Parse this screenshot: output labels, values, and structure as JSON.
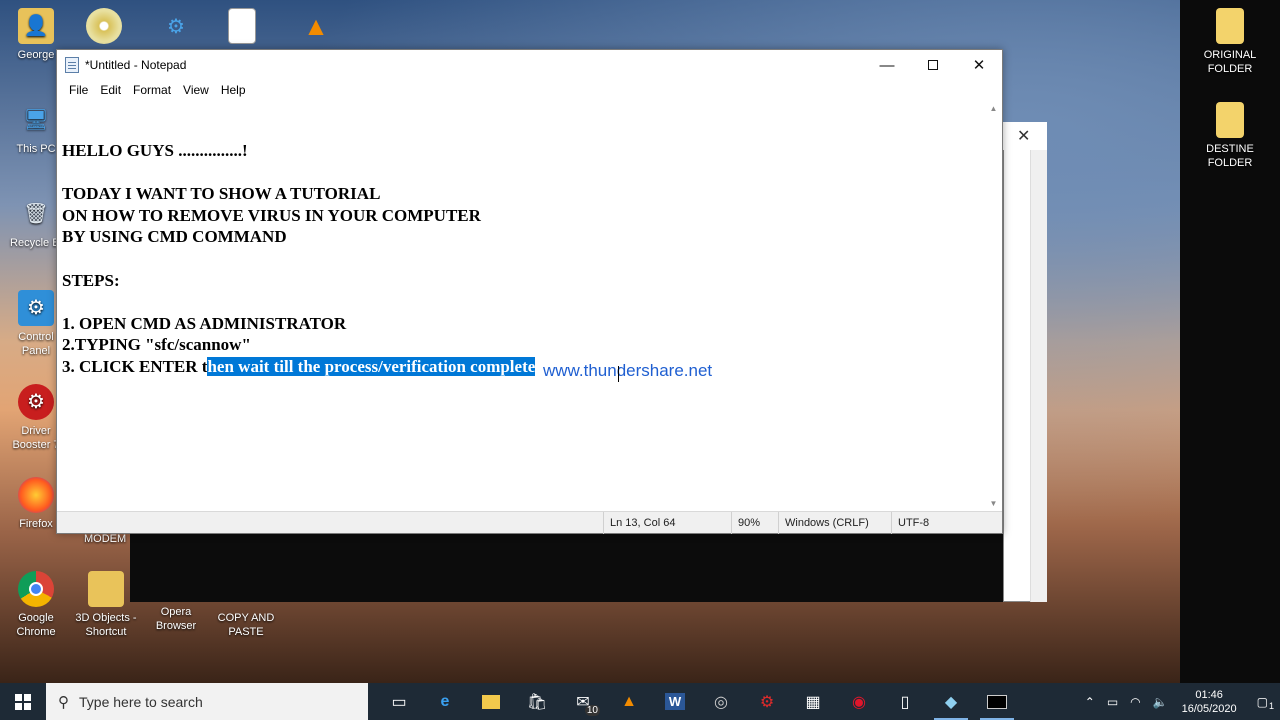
{
  "desktop": {
    "left_icons": [
      {
        "label": "George",
        "icon": "user-folder-icon"
      },
      {
        "label": "This PC",
        "icon": "computer-icon"
      },
      {
        "label": "Recycle Bi",
        "icon": "recycle-bin-icon"
      },
      {
        "label": "Control\nPanel",
        "icon": "control-panel-icon"
      },
      {
        "label": "Driver\nBooster 7",
        "icon": "driver-booster-icon"
      },
      {
        "label": "Firefox",
        "icon": "firefox-icon"
      },
      {
        "label": "Google\nChrome",
        "icon": "chrome-icon"
      }
    ],
    "right_icons": [
      {
        "label": "ORIGINAL\nFOLDER",
        "icon": "document-icon"
      },
      {
        "label": "DESTINE\nFOLDER",
        "icon": "document-icon"
      }
    ],
    "bottom_icons": [
      {
        "label": "3D Objects -\nShortcut",
        "icon": "folder-icon"
      },
      {
        "label": "Opera\nBrowser",
        "icon": "opera-icon"
      },
      {
        "label": "COPY AND\nPASTE",
        "icon": "vlc-icon"
      }
    ],
    "modem_label": "MODEM"
  },
  "notepad": {
    "title": "*Untitled - Notepad",
    "menu": [
      "File",
      "Edit",
      "Format",
      "View",
      "Help"
    ],
    "lines": [
      "HELLO GUYS ...............!",
      "",
      "TODAY I WANT TO SHOW A TUTORIAL",
      "ON HOW TO REMOVE VIRUS IN YOUR COMPUTER",
      "BY USING CMD COMMAND",
      "",
      "STEPS:",
      "",
      "1. OPEN CMD AS ADMINISTRATOR",
      "2.TYPING \"sfc/scannow\""
    ],
    "last_line_prefix": "3. CLICK ENTER t",
    "last_line_selected": "hen wait till the process/verification complete",
    "status": {
      "position": "Ln 13, Col 64",
      "zoom": "90%",
      "line_ending": "Windows (CRLF)",
      "encoding": "UTF-8"
    }
  },
  "watermark": "www.thundershare.net",
  "taskbar": {
    "search_placeholder": "Type here to search",
    "apps": [
      "task-view-icon",
      "edge-icon",
      "file-explorer-icon",
      "store-icon",
      "mail-icon",
      "vlc-icon",
      "word-icon",
      "app-icon",
      "driver-booster-icon",
      "photo-icon",
      "opera-icon",
      "notepad-icon",
      "paint-icon",
      "cmd-icon"
    ],
    "mail_badge": "10",
    "time": "01:46",
    "date": "16/05/2020",
    "notification_count": "1"
  }
}
